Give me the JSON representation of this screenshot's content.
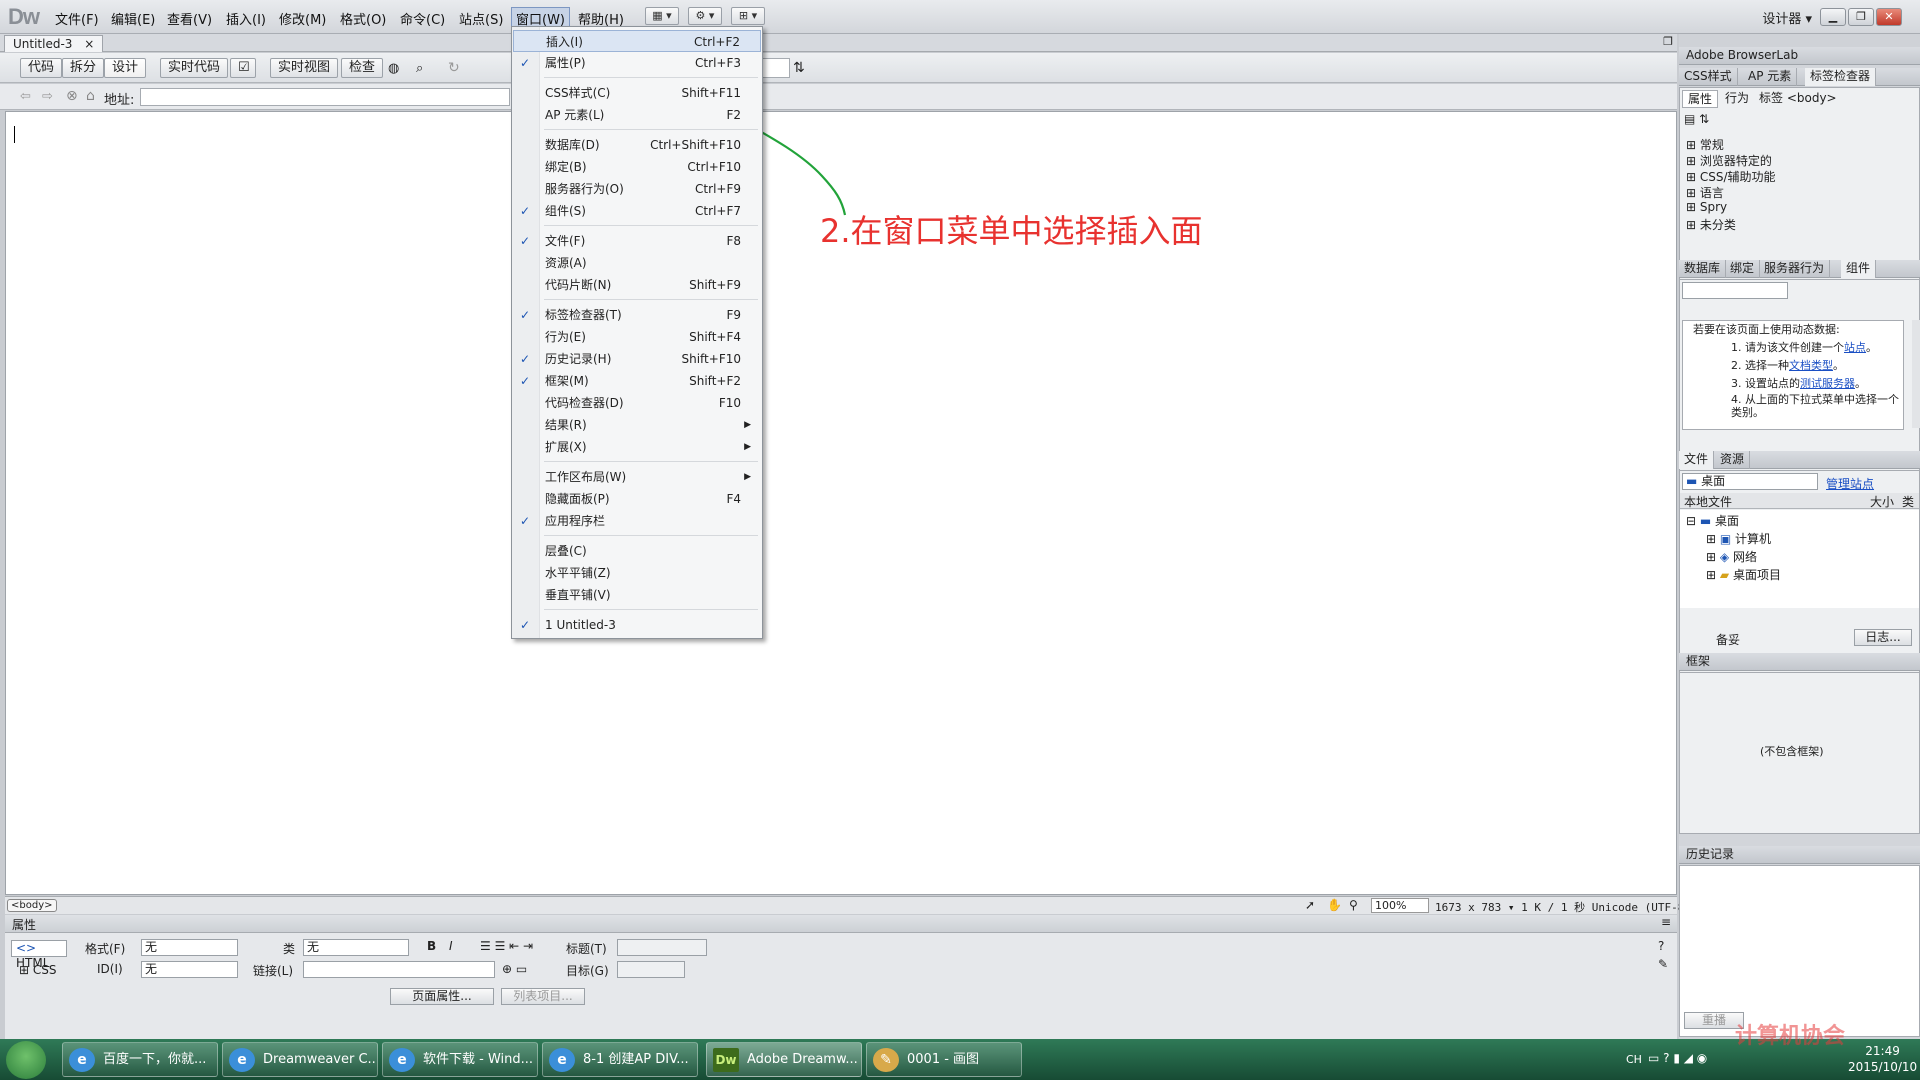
{
  "menubar": {
    "logo": "Dw",
    "items": [
      "文件(F)",
      "编辑(E)",
      "查看(V)",
      "插入(I)",
      "修改(M)",
      "格式(O)",
      "命令(C)",
      "站点(S)",
      "窗口(W)",
      "帮助(H)"
    ],
    "workspace": "设计器 ▾"
  },
  "document": {
    "tab": "Untitled-3",
    "views": [
      "代码",
      "拆分",
      "设计",
      "实时代码",
      "实时视图",
      "检查"
    ],
    "address_label": "地址:"
  },
  "annotation": "2.在窗口菜单中选择插入面",
  "window_menu": [
    {
      "label": "插入(I)",
      "shortcut": "Ctrl+F2",
      "checked": false,
      "highlighted": true
    },
    {
      "label": "属性(P)",
      "shortcut": "Ctrl+F3",
      "checked": true
    },
    {
      "label": "CSS样式(C)",
      "shortcut": "Shift+F11",
      "checked": false,
      "sep_before": true
    },
    {
      "label": "AP 元素(L)",
      "shortcut": "F2",
      "checked": false
    },
    {
      "label": "数据库(D)",
      "shortcut": "Ctrl+Shift+F10",
      "checked": false,
      "sep_before": true
    },
    {
      "label": "绑定(B)",
      "shortcut": "Ctrl+F10",
      "checked": false
    },
    {
      "label": "服务器行为(O)",
      "shortcut": "Ctrl+F9",
      "checked": false
    },
    {
      "label": "组件(S)",
      "shortcut": "Ctrl+F7",
      "checked": true
    },
    {
      "label": "文件(F)",
      "shortcut": "F8",
      "checked": true,
      "sep_before": true
    },
    {
      "label": "资源(A)",
      "shortcut": "",
      "checked": false
    },
    {
      "label": "代码片断(N)",
      "shortcut": "Shift+F9",
      "checked": false
    },
    {
      "label": "标签检查器(T)",
      "shortcut": "F9",
      "checked": true,
      "sep_before": true
    },
    {
      "label": "行为(E)",
      "shortcut": "Shift+F4",
      "checked": false
    },
    {
      "label": "历史记录(H)",
      "shortcut": "Shift+F10",
      "checked": true
    },
    {
      "label": "框架(M)",
      "shortcut": "Shift+F2",
      "checked": true
    },
    {
      "label": "代码检查器(D)",
      "shortcut": "F10",
      "checked": false
    },
    {
      "label": "结果(R)",
      "shortcut": "",
      "checked": false,
      "submenu": true
    },
    {
      "label": "扩展(X)",
      "shortcut": "",
      "checked": false,
      "submenu": true
    },
    {
      "label": "工作区布局(W)",
      "shortcut": "",
      "checked": false,
      "submenu": true,
      "sep_before": true
    },
    {
      "label": "隐藏面板(P)",
      "shortcut": "F4",
      "checked": false
    },
    {
      "label": "应用程序栏",
      "shortcut": "",
      "checked": true
    },
    {
      "label": "层叠(C)",
      "shortcut": "",
      "checked": false,
      "sep_before": true
    },
    {
      "label": "水平平铺(Z)",
      "shortcut": "",
      "checked": false
    },
    {
      "label": "垂直平铺(V)",
      "shortcut": "",
      "checked": false
    },
    {
      "label": "1 Untitled-3",
      "shortcut": "",
      "checked": true,
      "sep_before": true
    }
  ],
  "statusbar": {
    "tag": "<body>",
    "zoom": "100%",
    "info": "1673 x 783 ▾  1 K / 1 秒  Unicode (UTF-8)"
  },
  "properties": {
    "title": "属性",
    "html_label": "HTML",
    "css_label": "CSS",
    "format_label": "格式(F)",
    "format_value": "无",
    "id_label": "ID(I)",
    "id_value": "无",
    "class_label": "类",
    "class_value": "无",
    "link_label": "链接(L)",
    "title_label": "标题(T)",
    "target_label": "目标(G)",
    "page_props": "页面属性...",
    "list_item": "列表项目..."
  },
  "right_panel": {
    "browserlab": "Adobe BrowserLab",
    "tabs1": [
      "CSS样式",
      "AP 元素",
      "标签检查器"
    ],
    "subtabs": [
      "属性",
      "行为",
      "标签 <body>"
    ],
    "tag_groups": [
      "常规",
      "浏览器特定的",
      "CSS/辅助功能",
      "语言",
      "Spry",
      "未分类"
    ],
    "tabs2": [
      "数据库",
      "绑定",
      "服务器行为",
      "组件"
    ],
    "dyn_intro": "若要在该页面上使用动态数据:",
    "dyn_steps": [
      {
        "pre": "1. 请为该文件创建一个",
        "link": "站点",
        "post": "。"
      },
      {
        "pre": "2. 选择一种",
        "link": "文档类型",
        "post": "。"
      },
      {
        "pre": "3. 设置站点的",
        "link": "测试服务器",
        "post": "。"
      },
      {
        "pre": "4. 从上面的下拉式菜单中选择一个类别。",
        "link": "",
        "post": ""
      }
    ],
    "tabs3": [
      "文件",
      "资源"
    ],
    "site_select": "桌面",
    "manage_site": "管理站点",
    "files_cols": [
      "本地文件",
      "大小",
      "类"
    ],
    "tree": [
      "桌面",
      "计算机",
      "网络",
      "桌面项目"
    ],
    "ready": "备妥",
    "log_btn": "日志...",
    "frames_title": "框架",
    "frames_empty": "(不包含框架)",
    "history_title": "历史记录",
    "replay": "重播"
  },
  "taskbar": {
    "tasks": [
      {
        "label": "百度一下，你就...",
        "icon": "e"
      },
      {
        "label": "Dreamweaver C...",
        "icon": "e"
      },
      {
        "label": "软件下载 - Wind...",
        "icon": "e"
      },
      {
        "label": "8-1 创建AP DIV...",
        "icon": "e"
      },
      {
        "label": "Adobe Dreamw...",
        "icon": "Dw"
      },
      {
        "label": "0001 - 画图",
        "icon": "✎"
      }
    ],
    "lang": "CH",
    "time": "21:49",
    "date": "2015/10/10"
  },
  "watermark": "计算机协会",
  "colors": {
    "annotation": "#e8322f",
    "arrow": "#22a33a",
    "link": "#1a4fc4",
    "taskbar": "#1f5e41"
  }
}
